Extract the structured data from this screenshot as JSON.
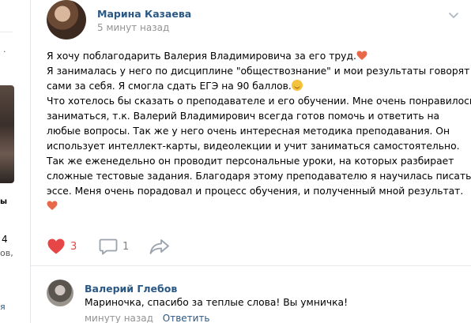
{
  "sidebar": {
    "mark": ".",
    "label_1": "ы",
    "count": "4",
    "label_2": "ов,",
    "label_3": "я"
  },
  "post": {
    "author": "Марина Казаева",
    "time": "5 минут назад",
    "lines": [
      "Я хочу поблагодарить Валерия Владимировича за его труд.",
      "Я занималась у него по дисциплине \"обществознание\" и мои результаты говорят",
      "сами за себя. Я смогла сдать ЕГЭ на 90 баллов.",
      "Что хотелось бы сказать о преподавателе и его обучении. Мне очень понравилось",
      "заниматься, т.к. Валерий Владимирович всегда готов помочь и ответить на",
      "любые вопросы. Так же у него очень интересная методика преподавания. Он",
      "использует интеллект-карты, видеолекции и учит заниматься самостоятельно.",
      "Так же еженедельно он проводит персональные уроки, на которых разбирает",
      "сложные тестовые задания. Благодаря этому преподавателю я научилась писать",
      "эссе. Меня очень порадовал и процесс обучения, и полученный мной результат."
    ],
    "emoji_heart": "heart-emoji",
    "emoji_smile": "smile-emoji",
    "likes": "3",
    "comments": "1",
    "like_color": "#e64646",
    "link_color": "#2a5885"
  },
  "comment": {
    "author": "Валерий Глебов",
    "text": "Мариночка, спасибо за теплые слова! Вы умничка!",
    "time": "минуту назад",
    "reply": "Ответить"
  }
}
